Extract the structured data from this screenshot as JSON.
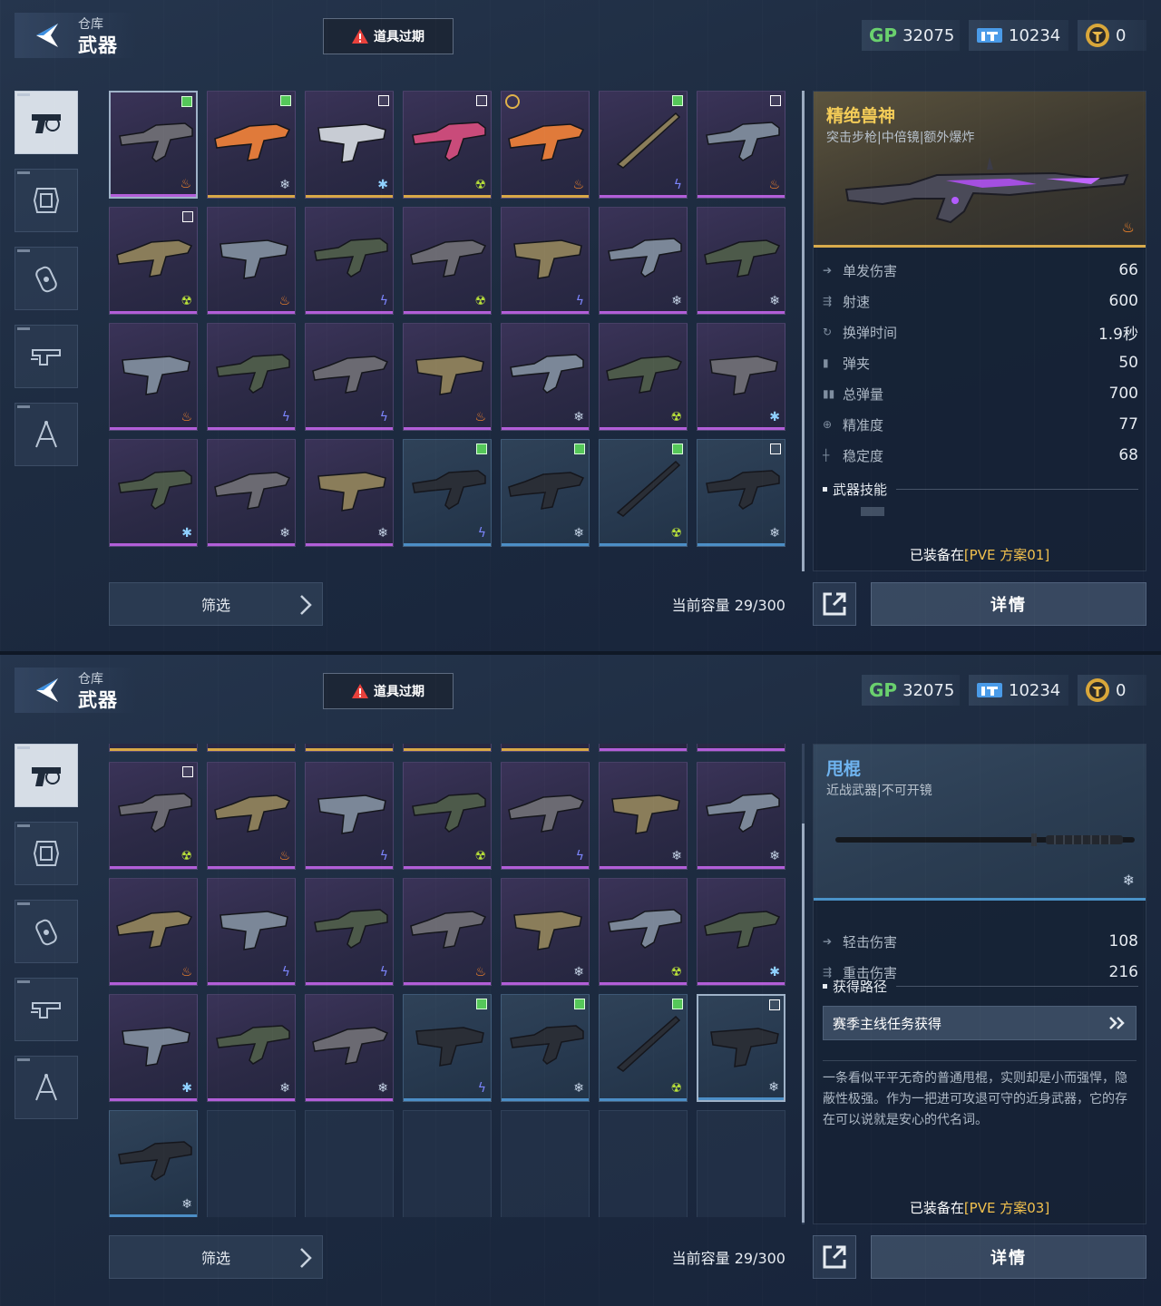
{
  "screens": [
    {
      "topbar": {
        "crumb": "仓库",
        "title": "武器",
        "expired_label": "道具过期",
        "gp_label": "GP",
        "gp_value": "32075",
        "ticket_value": "10234",
        "coin_value": "0"
      },
      "categories": [
        "pistol",
        "frame",
        "grenade",
        "gun-parts",
        "compass"
      ],
      "active_category": "pistol",
      "grid": {
        "rows": [
          [
            {
              "tier": "purple",
              "check": "on",
              "element": "fire",
              "selected": true
            },
            {
              "tier": "gold",
              "check": "on",
              "element": "ice"
            },
            {
              "tier": "gold",
              "check": "off",
              "element": "frost"
            },
            {
              "tier": "gold",
              "check": "off",
              "element": "toxic"
            },
            {
              "tier": "gold",
              "check": "none",
              "element": "fire",
              "timed": true
            },
            {
              "tier": "purple",
              "check": "on",
              "element": "bolt"
            },
            {
              "tier": "purple",
              "check": "off",
              "element": "fire"
            }
          ],
          [
            {
              "tier": "purple",
              "check": "off",
              "element": "toxic"
            },
            {
              "tier": "purple",
              "check": "none",
              "element": "fire"
            },
            {
              "tier": "purple",
              "check": "none",
              "element": "bolt"
            },
            {
              "tier": "purple",
              "check": "none",
              "element": "toxic"
            },
            {
              "tier": "purple",
              "check": "none",
              "element": "bolt"
            },
            {
              "tier": "purple",
              "check": "none",
              "element": "ice"
            },
            {
              "tier": "purple",
              "check": "none",
              "element": "ice"
            }
          ],
          [
            {
              "tier": "purple",
              "check": "none",
              "element": "fire"
            },
            {
              "tier": "purple",
              "check": "none",
              "element": "bolt"
            },
            {
              "tier": "purple",
              "check": "none",
              "element": "bolt"
            },
            {
              "tier": "purple",
              "check": "none",
              "element": "fire"
            },
            {
              "tier": "purple",
              "check": "none",
              "element": "ice"
            },
            {
              "tier": "purple",
              "check": "none",
              "element": "toxic"
            },
            {
              "tier": "purple",
              "check": "none",
              "element": "frost"
            }
          ],
          [
            {
              "tier": "purple",
              "check": "none",
              "element": "frost"
            },
            {
              "tier": "purple",
              "check": "none",
              "element": "ice"
            },
            {
              "tier": "purple",
              "check": "none",
              "element": "ice"
            },
            {
              "tier": "blue",
              "check": "on",
              "element": "bolt"
            },
            {
              "tier": "blue",
              "check": "on",
              "element": "ice"
            },
            {
              "tier": "blue",
              "check": "on",
              "element": "toxic"
            },
            {
              "tier": "blue",
              "check": "off",
              "element": "ice"
            }
          ]
        ]
      },
      "filter_label": "筛选",
      "capacity": "当前容量 29/300",
      "detail_label": "详情",
      "panel": {
        "name": "精绝兽神",
        "subtitle": "突击步枪|中倍镜|额外爆炸",
        "stats": [
          {
            "label": "单发伤害",
            "value": "66"
          },
          {
            "label": "射速",
            "value": "600"
          },
          {
            "label": "换弹时间",
            "value": "1.9秒"
          },
          {
            "label": "弹夹",
            "value": "50"
          },
          {
            "label": "总弹量",
            "value": "700"
          },
          {
            "label": "精准度",
            "value": "77"
          },
          {
            "label": "稳定度",
            "value": "68"
          }
        ],
        "section": "武器技能",
        "equipped_prefix": "已装备在",
        "equipped_plan": "[PVE 方案01]"
      }
    },
    {
      "topbar": {
        "crumb": "仓库",
        "title": "武器",
        "expired_label": "道具过期",
        "gp_label": "GP",
        "gp_value": "32075",
        "ticket_value": "10234",
        "coin_value": "0"
      },
      "grid": {
        "rows": [
          [
            {
              "tier": "purple",
              "check": "off",
              "element": "toxic"
            },
            {
              "tier": "purple",
              "check": "none",
              "element": "fire"
            },
            {
              "tier": "purple",
              "check": "none",
              "element": "bolt"
            },
            {
              "tier": "purple",
              "check": "none",
              "element": "toxic"
            },
            {
              "tier": "purple",
              "check": "none",
              "element": "bolt"
            },
            {
              "tier": "purple",
              "check": "none",
              "element": "ice"
            },
            {
              "tier": "purple",
              "check": "none",
              "element": "ice"
            }
          ],
          [
            {
              "tier": "purple",
              "check": "none",
              "element": "fire"
            },
            {
              "tier": "purple",
              "check": "none",
              "element": "bolt"
            },
            {
              "tier": "purple",
              "check": "none",
              "element": "bolt"
            },
            {
              "tier": "purple",
              "check": "none",
              "element": "fire"
            },
            {
              "tier": "purple",
              "check": "none",
              "element": "ice"
            },
            {
              "tier": "purple",
              "check": "none",
              "element": "toxic"
            },
            {
              "tier": "purple",
              "check": "none",
              "element": "frost"
            }
          ],
          [
            {
              "tier": "purple",
              "check": "none",
              "element": "frost"
            },
            {
              "tier": "purple",
              "check": "none",
              "element": "ice"
            },
            {
              "tier": "purple",
              "check": "none",
              "element": "ice"
            },
            {
              "tier": "blue",
              "check": "on",
              "element": "bolt"
            },
            {
              "tier": "blue",
              "check": "on",
              "element": "ice"
            },
            {
              "tier": "blue",
              "check": "on",
              "element": "toxic"
            },
            {
              "tier": "blue",
              "check": "off",
              "element": "ice",
              "selected": true
            }
          ],
          [
            {
              "tier": "blue",
              "check": "none",
              "element": "ice"
            },
            {
              "tier": "empty"
            },
            {
              "tier": "empty"
            },
            {
              "tier": "empty"
            },
            {
              "tier": "empty"
            },
            {
              "tier": "empty"
            },
            {
              "tier": "empty"
            }
          ]
        ]
      },
      "filter_label": "筛选",
      "capacity": "当前容量 29/300",
      "detail_label": "详情",
      "panel": {
        "name": "甩棍",
        "subtitle": "近战武器|不可开镜",
        "stats": [
          {
            "label": "轻击伤害",
            "value": "108"
          },
          {
            "label": "重击伤害",
            "value": "216"
          }
        ],
        "section": "获得路径",
        "source": "赛季主线任务获得",
        "description": "一条看似平平无奇的普通甩棍，实则却是小而强悍，隐蔽性极强。作为一把进可攻退可守的近身武器，它的存在可以说就是安心的代名词。",
        "equipped_prefix": "已装备在",
        "equipped_plan": "[PVE 方案03]"
      }
    }
  ],
  "colors": {
    "gold_accent": "#d8ab4c",
    "purple_tier": "#b25ed8",
    "blue_tier": "#4c8ec6",
    "check_green": "#55c759",
    "title_gold": "#f4cc58",
    "title_blue": "#6fb4f0"
  }
}
